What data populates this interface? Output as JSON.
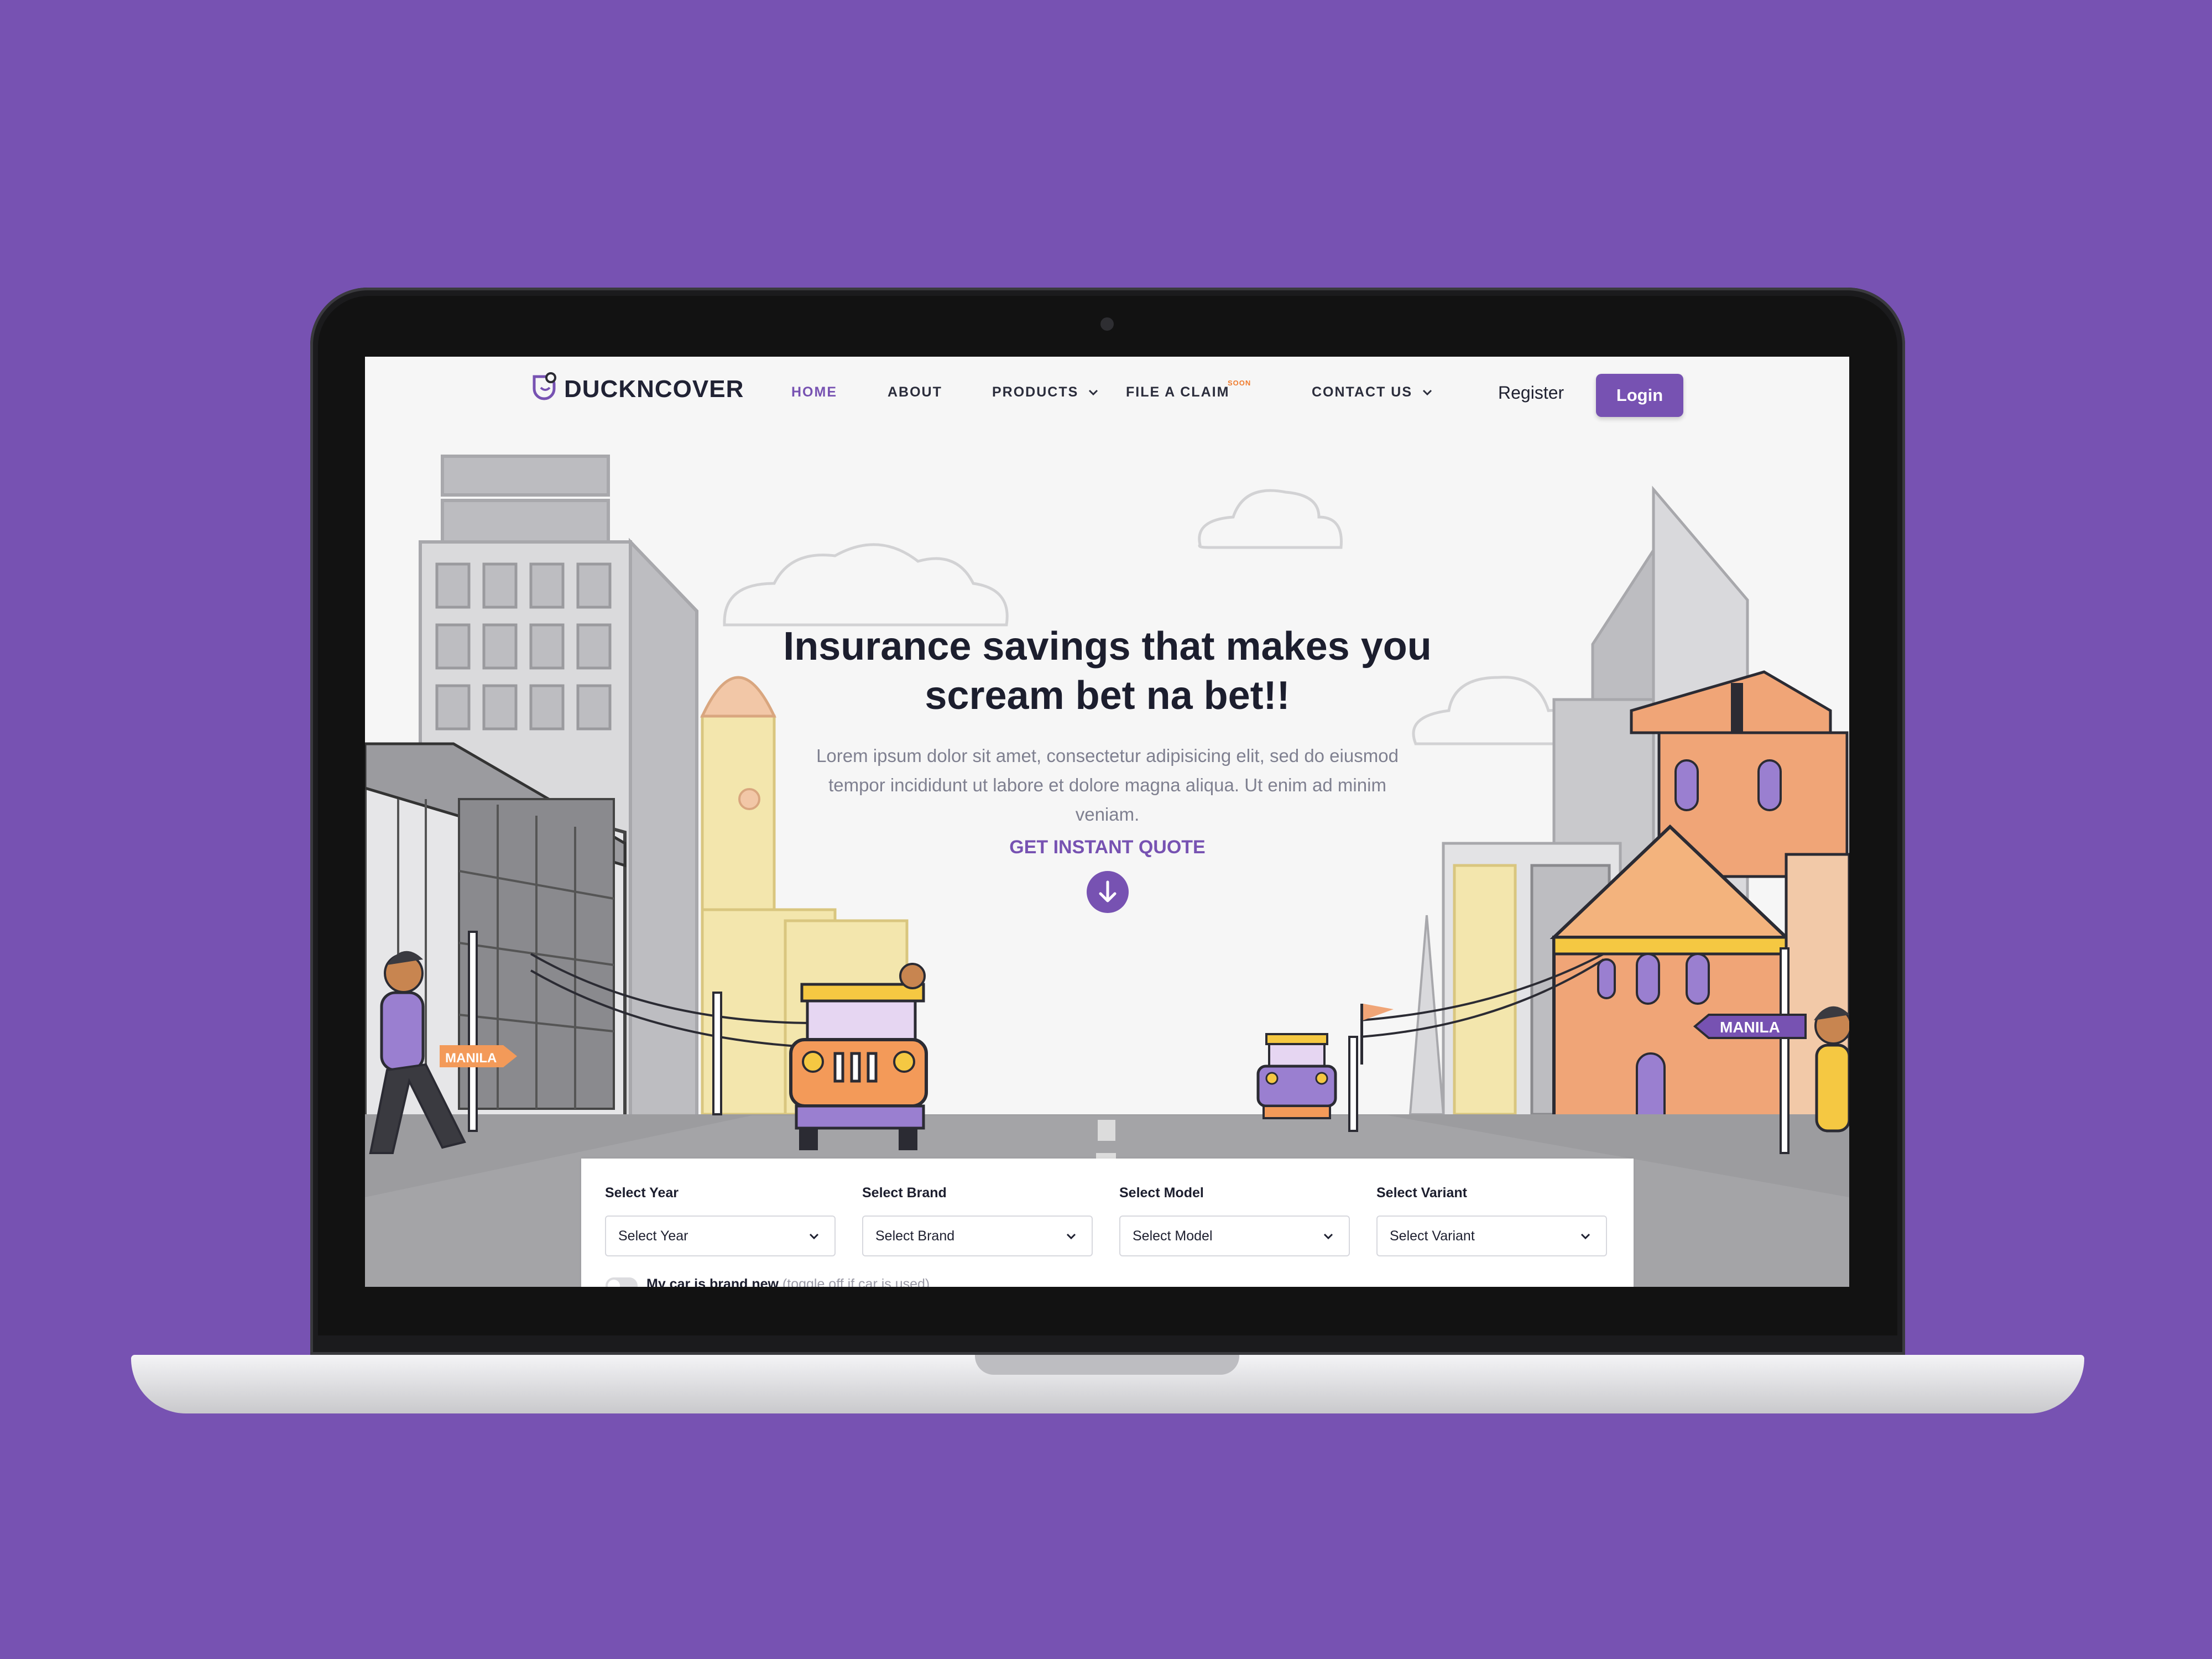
{
  "brand": {
    "name": "DUCKNCOVER",
    "accent": "#7752b2",
    "background": "#7752b2"
  },
  "nav": {
    "items": [
      {
        "label": "HOME",
        "active": true
      },
      {
        "label": "ABOUT"
      },
      {
        "label": "PRODUCTS",
        "dropdown": true
      },
      {
        "label": "FILE A CLAIM",
        "badge": "SOON"
      },
      {
        "label": "CONTACT US",
        "dropdown": true
      }
    ],
    "register": "Register",
    "login": "Login"
  },
  "hero": {
    "title": "Insurance savings that makes you scream bet na bet!!",
    "subtitle": "Lorem ipsum dolor sit amet, consectetur adipisicing elit, sed do eiusmod tempor incididunt ut labore et dolore magna aliqua. Ut enim ad minim veniam.",
    "cta": "GET INSTANT QUOTE",
    "cta_icon": "arrow-down-circle-icon"
  },
  "scene": {
    "sign_left": "MANILA",
    "sign_right": "MANILA"
  },
  "quote_form": {
    "fields": [
      {
        "label": "Select Year",
        "value": "Select Year"
      },
      {
        "label": "Select Brand",
        "value": "Select Brand"
      },
      {
        "label": "Select Model",
        "value": "Select Model"
      },
      {
        "label": "Select Variant",
        "value": "Select Variant"
      }
    ],
    "toggle_label": "My car is brand new",
    "toggle_hint": "(toggle off if car is used)"
  }
}
